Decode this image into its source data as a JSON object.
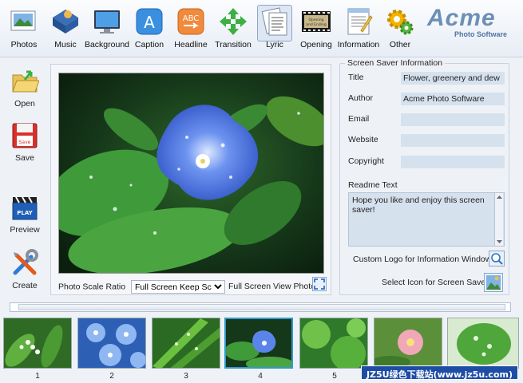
{
  "toolbar": {
    "items": [
      {
        "label": "Photos"
      },
      {
        "label": "Music"
      },
      {
        "label": "Background"
      },
      {
        "label": "Caption"
      },
      {
        "label": "Headline"
      },
      {
        "label": "Transition"
      },
      {
        "label": "Lyric"
      },
      {
        "label": "Opening"
      },
      {
        "label": "Information"
      },
      {
        "label": "Other"
      }
    ],
    "active": "Lyric"
  },
  "logo": {
    "big": "Acme",
    "small": "Photo Software"
  },
  "sidebar": {
    "items": [
      {
        "label": "Open"
      },
      {
        "label": "Save"
      },
      {
        "label": "Preview"
      },
      {
        "label": "Create"
      }
    ],
    "save_icon_text": "Save",
    "play_icon_text": "PLAY"
  },
  "opening_icon": {
    "line1": "Opening",
    "line2": "and Ending"
  },
  "preview": {
    "scale_label": "Photo Scale Ratio",
    "scale_value": "Full Screen Keep Scale",
    "fullscreen_label": "Full Screen View Photo"
  },
  "info": {
    "legend": "Screen Saver Information",
    "fields": {
      "title": {
        "label": "Title",
        "value": "Flower, greenery and dew"
      },
      "author": {
        "label": "Author",
        "value": "Acme Photo Software"
      },
      "email": {
        "label": "Email",
        "value": ""
      },
      "website": {
        "label": "Website",
        "value": ""
      },
      "copyright": {
        "label": "Copyright",
        "value": ""
      }
    },
    "readme_label": "Readme Text",
    "readme_value": "Hope you like and enjoy this screen saver!",
    "custom_logo_label": "Custom Logo for Information Window",
    "select_icon_label": "Select Icon for Screen Saver"
  },
  "thumbnails": {
    "numbers": [
      "1",
      "2",
      "3",
      "4",
      "5"
    ],
    "selected": "4"
  },
  "watermark": "JZ5U绿色下载站(www.jz5u.com)",
  "colors": {
    "accent": "#3399cc",
    "field_bg": "#d6e1ee",
    "logo_blue": "#6e8fb5"
  }
}
